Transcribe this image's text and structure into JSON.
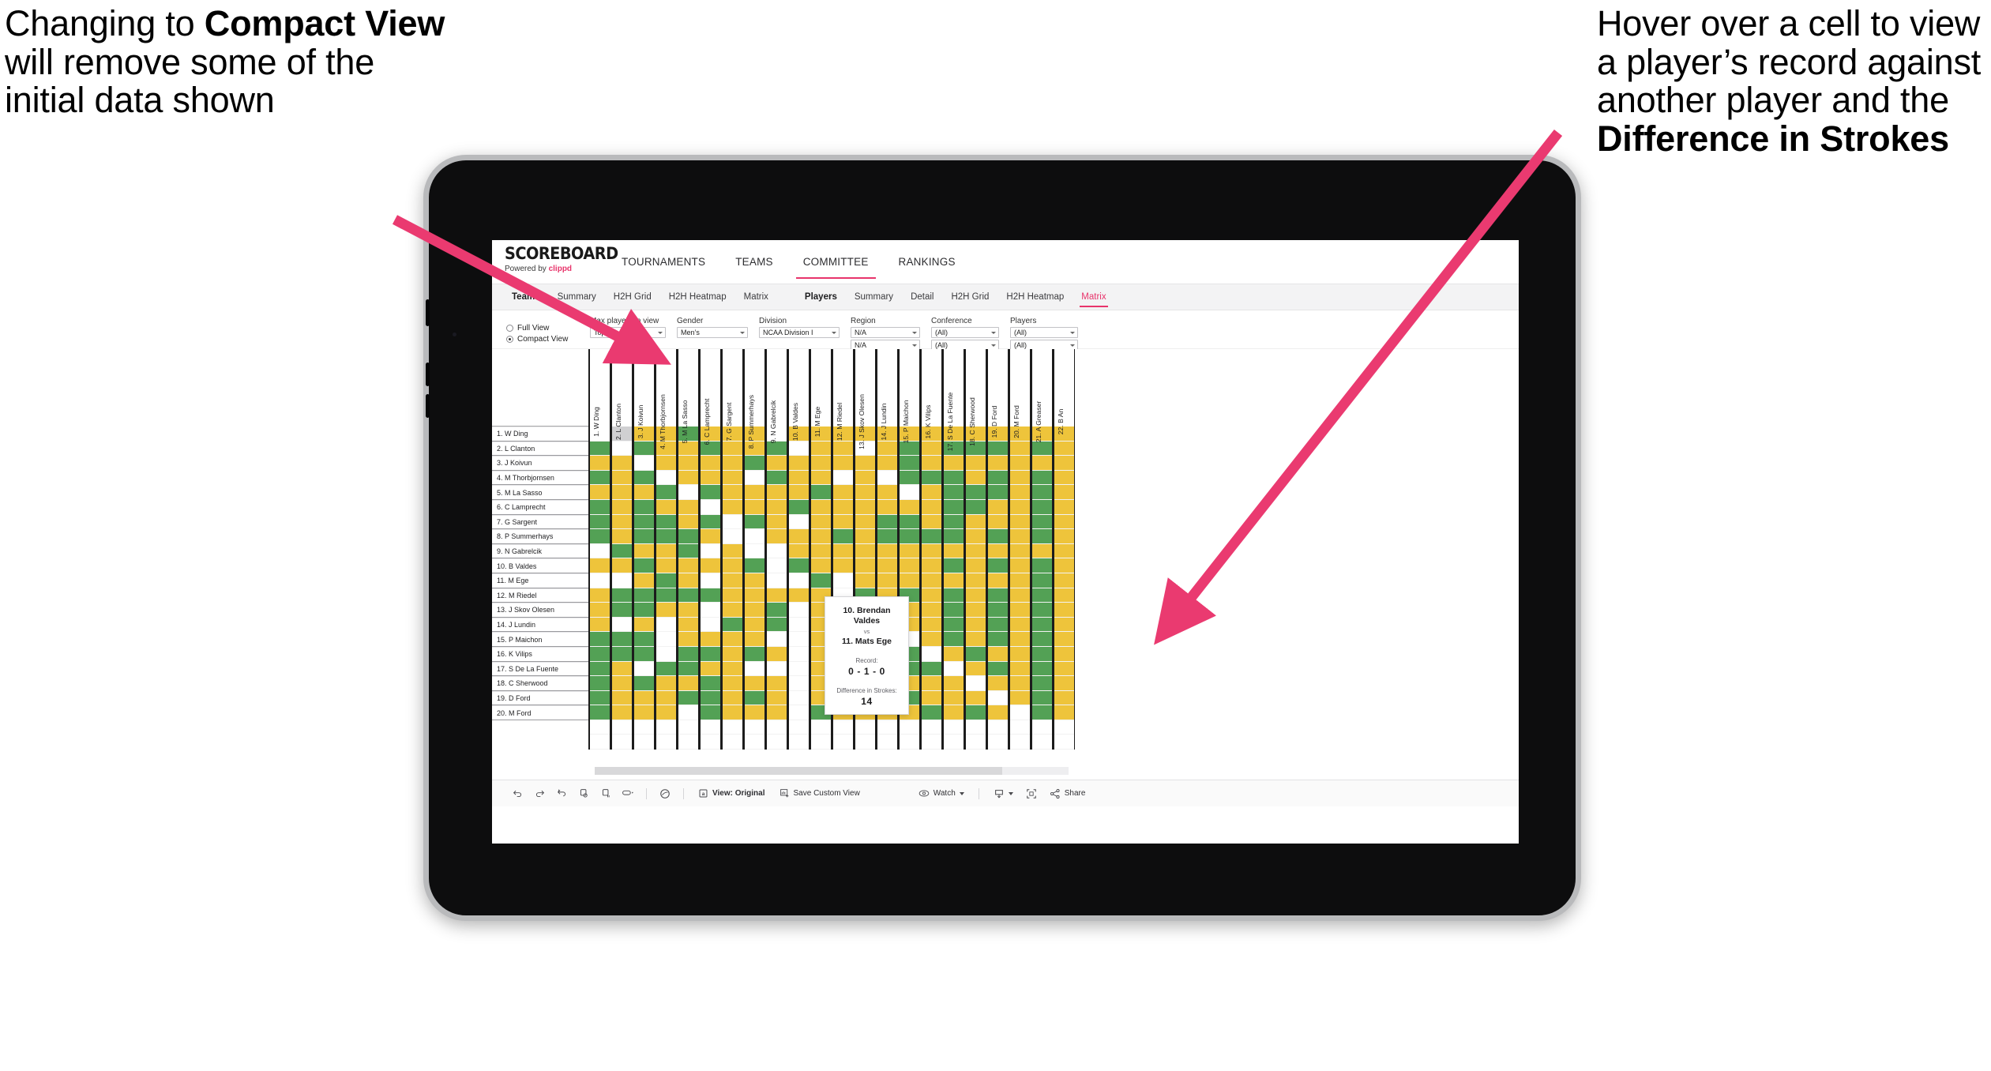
{
  "annotations": {
    "left": {
      "pre": "Changing to ",
      "bold": "Compact View",
      "post": " will remove some of the initial data shown"
    },
    "right": {
      "pre": "Hover over a cell to view a player’s record against another player and the ",
      "bold": "Difference in Strokes",
      "post": ""
    },
    "arrow_color": "#ea3a70"
  },
  "app": {
    "logo": {
      "word": "SCOREBOARD",
      "powered_by": "Powered by ",
      "brand": "clippd"
    },
    "top_nav": [
      {
        "label": "TOURNAMENTS",
        "active": false
      },
      {
        "label": "TEAMS",
        "active": false
      },
      {
        "label": "COMMITTEE",
        "active": true
      },
      {
        "label": "RANKINGS",
        "active": false
      }
    ],
    "sub_nav_teams": [
      {
        "label": "Teams",
        "head": true,
        "active": false
      },
      {
        "label": "Summary",
        "head": false,
        "active": false
      },
      {
        "label": "H2H Grid",
        "head": false,
        "active": false
      },
      {
        "label": "H2H Heatmap",
        "head": false,
        "active": false
      },
      {
        "label": "Matrix",
        "head": false,
        "active": false
      }
    ],
    "sub_nav_players": [
      {
        "label": "Players",
        "head": true,
        "active": false
      },
      {
        "label": "Summary",
        "head": false,
        "active": false
      },
      {
        "label": "Detail",
        "head": false,
        "active": false
      },
      {
        "label": "H2H Grid",
        "head": false,
        "active": false
      },
      {
        "label": "H2H Heatmap",
        "head": false,
        "active": false
      },
      {
        "label": "Matrix",
        "head": false,
        "active": true
      }
    ],
    "accent_color": "#e8346b"
  },
  "filters": {
    "view_mode": {
      "full_label": "Full View",
      "compact_label": "Compact View",
      "selected": "Compact View"
    },
    "controls": [
      {
        "label": "Max players in view",
        "value": "Top 25",
        "width": "w1"
      },
      {
        "label": "Gender",
        "value": "Men’s",
        "width": "w2"
      },
      {
        "label": "Division",
        "value": "NCAA Division I",
        "width": "w3"
      },
      {
        "label": "Region",
        "value": "N/A",
        "value2": "N/A",
        "width": "w4"
      },
      {
        "label": "Conference",
        "value": "(All)",
        "value2": "(All)",
        "width": "w5"
      },
      {
        "label": "Players",
        "value": "(All)",
        "value2": "(All)",
        "width": "w6"
      }
    ]
  },
  "matrix": {
    "row_labels": [
      "1. W Ding",
      "2. L Clanton",
      "3. J Koivun",
      "4. M Thorbjornsen",
      "5. M La Sasso",
      "6. C Lamprecht",
      "7. G Sargent",
      "8. P Summerhays",
      "9. N Gabrelcik",
      "10. B Valdes",
      "11. M Ege",
      "12. M Riedel",
      "13. J Skov Olesen",
      "14. J Lundin",
      "15. P Maichon",
      "16. K Vilips",
      "17. S De La Fuente",
      "18. C Sherwood",
      "19. D Ford",
      "20. M Ford"
    ],
    "col_labels": [
      "1. W Ding",
      "2. L Clanton",
      "3. J Koivun",
      "4. M Thorbjornsen",
      "5. M La Sasso",
      "6. C Lamprecht",
      "7. G Sargent",
      "8. P Summerhays",
      "9. N Gabrelcik",
      "10. B Valdes",
      "11. M Ege",
      "12. M Riedel",
      "13. J Skov Olesen",
      "14. J Lundin",
      "15. P Maichon",
      "16. K Vilips",
      "17. S De La Fuente",
      "18. C Sherwood",
      "19. D Ford",
      "20. M Ford",
      "21. A Greaser",
      "22. B An"
    ],
    "legend_colors": {
      "win": "#53a155",
      "tie": "#eec43b",
      "loss": "#d0d0d2",
      "none": "#ffffff"
    },
    "cells": [
      [
        "w",
        "g",
        "y",
        "y",
        "G",
        "y",
        "y",
        "y",
        "w",
        "y",
        "y",
        "y",
        "y",
        "y",
        "y",
        "y",
        "y",
        "y",
        "y",
        "y",
        "y",
        "y"
      ],
      [
        "G",
        "w",
        "G",
        "y",
        "y",
        "G",
        "y",
        "y",
        "G",
        "w",
        "y",
        "y",
        "w",
        "y",
        "G",
        "y",
        "G",
        "G",
        "G",
        "y",
        "G",
        "y"
      ],
      [
        "y",
        "y",
        "w",
        "y",
        "y",
        "y",
        "y",
        "G",
        "y",
        "y",
        "y",
        "y",
        "y",
        "y",
        "G",
        "y",
        "y",
        "y",
        "y",
        "y",
        "y",
        "y"
      ],
      [
        "G",
        "y",
        "G",
        "w",
        "y",
        "y",
        "y",
        "w",
        "G",
        "y",
        "y",
        "w",
        "y",
        "w",
        "G",
        "G",
        "G",
        "y",
        "G",
        "y",
        "G",
        "y"
      ],
      [
        "y",
        "y",
        "y",
        "G",
        "w",
        "G",
        "y",
        "y",
        "y",
        "y",
        "G",
        "y",
        "y",
        "y",
        "w",
        "y",
        "G",
        "G",
        "G",
        "y",
        "G",
        "y"
      ],
      [
        "G",
        "y",
        "G",
        "y",
        "y",
        "w",
        "y",
        "y",
        "y",
        "G",
        "y",
        "y",
        "y",
        "y",
        "y",
        "y",
        "G",
        "G",
        "y",
        "y",
        "G",
        "y"
      ],
      [
        "G",
        "y",
        "G",
        "G",
        "y",
        "G",
        "w",
        "G",
        "y",
        "w",
        "y",
        "y",
        "y",
        "G",
        "G",
        "y",
        "G",
        "y",
        "y",
        "y",
        "G",
        "y"
      ],
      [
        "G",
        "y",
        "G",
        "G",
        "G",
        "y",
        "w",
        "w",
        "y",
        "y",
        "y",
        "G",
        "y",
        "G",
        "G",
        "G",
        "G",
        "y",
        "G",
        "y",
        "G",
        "y"
      ],
      [
        "w",
        "G",
        "y",
        "y",
        "G",
        "w",
        "y",
        "w",
        "w",
        "y",
        "y",
        "y",
        "y",
        "y",
        "y",
        "y",
        "y",
        "y",
        "y",
        "y",
        "y",
        "y"
      ],
      [
        "y",
        "y",
        "G",
        "y",
        "y",
        "y",
        "y",
        "G",
        "w",
        "G",
        "y",
        "y",
        "y",
        "y",
        "y",
        "y",
        "G",
        "y",
        "G",
        "y",
        "G",
        "y"
      ],
      [
        "w",
        "w",
        "y",
        "G",
        "y",
        "w",
        "y",
        "y",
        "w",
        "w",
        "G",
        "w",
        "y",
        "y",
        "y",
        "y",
        "y",
        "y",
        "y",
        "y",
        "G",
        "y"
      ],
      [
        "y",
        "G",
        "G",
        "G",
        "G",
        "G",
        "y",
        "y",
        "y",
        "y",
        "y",
        "w",
        "G",
        "y",
        "G",
        "y",
        "G",
        "y",
        "G",
        "y",
        "G",
        "y"
      ],
      [
        "y",
        "G",
        "G",
        "y",
        "y",
        "w",
        "y",
        "y",
        "G",
        "w",
        "y",
        "y",
        "w",
        "y",
        "y",
        "y",
        "G",
        "y",
        "G",
        "y",
        "G",
        "y"
      ],
      [
        "y",
        "w",
        "y",
        "w",
        "y",
        "w",
        "G",
        "y",
        "G",
        "w",
        "y",
        "y",
        "y",
        "w",
        "y",
        "y",
        "G",
        "y",
        "G",
        "y",
        "G",
        "y"
      ],
      [
        "G",
        "G",
        "G",
        "w",
        "y",
        "y",
        "y",
        "y",
        "w",
        "w",
        "y",
        "y",
        "y",
        "y",
        "w",
        "y",
        "G",
        "y",
        "G",
        "y",
        "G",
        "y"
      ],
      [
        "G",
        "G",
        "G",
        "w",
        "G",
        "G",
        "y",
        "G",
        "y",
        "w",
        "y",
        "y",
        "y",
        "y",
        "G",
        "w",
        "y",
        "G",
        "y",
        "y",
        "G",
        "y"
      ],
      [
        "G",
        "y",
        "w",
        "G",
        "G",
        "y",
        "y",
        "w",
        "w",
        "w",
        "y",
        "y",
        "y",
        "y",
        "G",
        "G",
        "w",
        "y",
        "G",
        "y",
        "G",
        "y"
      ],
      [
        "G",
        "y",
        "G",
        "y",
        "y",
        "G",
        "y",
        "y",
        "y",
        "w",
        "y",
        "y",
        "G",
        "G",
        "y",
        "y",
        "y",
        "w",
        "y",
        "y",
        "G",
        "y"
      ],
      [
        "G",
        "y",
        "y",
        "y",
        "G",
        "G",
        "y",
        "G",
        "y",
        "w",
        "y",
        "y",
        "G",
        "y",
        "G",
        "y",
        "y",
        "y",
        "w",
        "y",
        "G",
        "y"
      ],
      [
        "G",
        "y",
        "y",
        "y",
        "w",
        "G",
        "y",
        "y",
        "y",
        "w",
        "G",
        "y",
        "y",
        "y",
        "y",
        "G",
        "y",
        "G",
        "y",
        "w",
        "G",
        "y"
      ]
    ]
  },
  "tooltip": {
    "player_a": "10. Brendan Valdes",
    "vs": "vs",
    "player_b": "11. Mats Ege",
    "record_label": "Record:",
    "record_value": "0 - 1 - 0",
    "strokes_label": "Difference in Strokes:",
    "strokes_value": "14"
  },
  "toolbar": {
    "icons": [
      "undo-icon",
      "redo-icon",
      "revert-icon",
      "refresh-icon",
      "pause-icon",
      "subscribe-icon"
    ],
    "help_icon": "help-icon",
    "view_button": "View: Original",
    "save_button": "Save Custom View",
    "watch_button": "Watch",
    "download_icon": "download-icon",
    "fullscreen_icon": "fullscreen-icon",
    "share_button": "Share"
  }
}
